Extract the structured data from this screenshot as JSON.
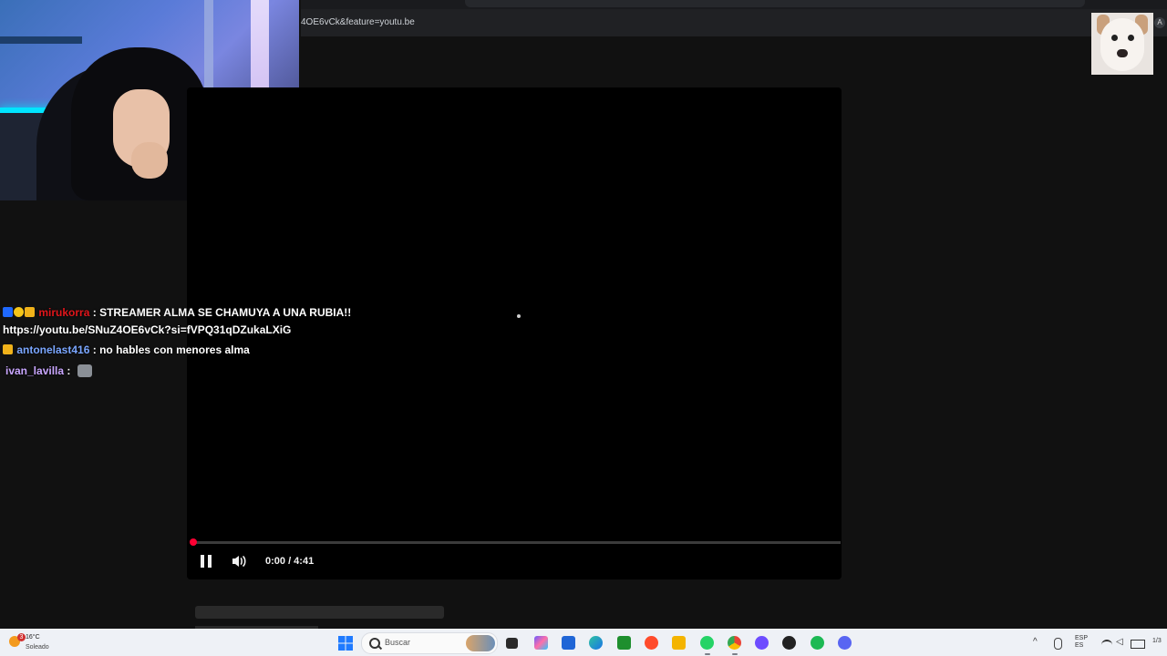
{
  "browser": {
    "url_fragment": "4OE6vCk&feature=youtu.be"
  },
  "player": {
    "time_display": "0:00 / 4:41",
    "progress": 0.0
  },
  "chat": {
    "messages": [
      {
        "badges": [
          "prime-badge",
          "1-badge",
          "crown-badge"
        ],
        "user": "mirukorra",
        "separator": ":",
        "text": "STREAMER ALMA SE CHAMUYA A UNA RUBIA!!",
        "continuation": "https://youtu.be/SNuZ4OE6vCk?si=fVPQ31qDZukaLXiG"
      },
      {
        "badges": [
          "crown-badge"
        ],
        "user": "antonelast416",
        "separator": ":",
        "text": "no hables con menores alma"
      },
      {
        "badges": [],
        "user": "ivan_lavilla",
        "separator": ":",
        "text": "",
        "emote": "cat-emote"
      }
    ]
  },
  "profile": {
    "badge": "A"
  },
  "taskbar": {
    "weather_temp": "16°C",
    "weather_condition": "Soleado",
    "weather_alert_count": "3",
    "search_placeholder": "Buscar",
    "lang_top": "ESP",
    "lang_bottom": "ES",
    "clock_partial": "1/3",
    "apps": [
      "start-icon",
      "task-view-icon",
      "copilot-icon",
      "store-icon",
      "edge-icon",
      "xbox-icon",
      "opera-gx-icon",
      "file-explorer-icon",
      "whatsapp-icon",
      "chrome-icon",
      "obs-icon",
      "davinci-icon",
      "spotify-icon",
      "discord-icon"
    ]
  }
}
